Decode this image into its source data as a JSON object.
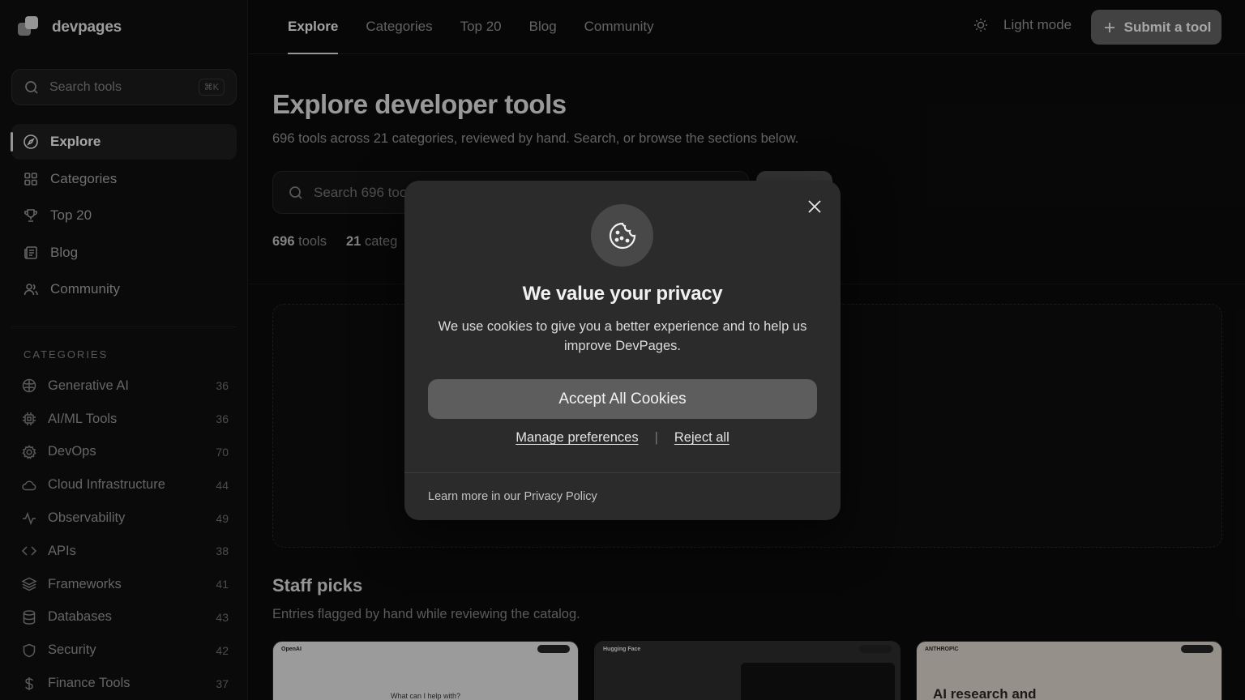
{
  "brand": {
    "name": "devpages"
  },
  "sidebar": {
    "search_placeholder": "Search tools",
    "search_shortcut": "⌘K",
    "nav": [
      {
        "label": "Explore",
        "icon": "compass-icon",
        "active": true
      },
      {
        "label": "Categories",
        "icon": "grid-icon",
        "active": false
      },
      {
        "label": "Top 20",
        "icon": "trophy-icon",
        "active": false
      },
      {
        "label": "Blog",
        "icon": "newspaper-icon",
        "active": false
      },
      {
        "label": "Community",
        "icon": "users-icon",
        "active": false
      }
    ],
    "categories_heading": "CATEGORIES",
    "categories": [
      {
        "label": "Generative AI",
        "count": "36",
        "icon": "brain-icon"
      },
      {
        "label": "AI/ML Tools",
        "count": "36",
        "icon": "cpu-icon"
      },
      {
        "label": "DevOps",
        "count": "70",
        "icon": "gear-icon"
      },
      {
        "label": "Cloud Infrastructure",
        "count": "44",
        "icon": "cloud-icon"
      },
      {
        "label": "Observability",
        "count": "49",
        "icon": "activity-icon"
      },
      {
        "label": "APIs",
        "count": "38",
        "icon": "code-icon"
      },
      {
        "label": "Frameworks",
        "count": "41",
        "icon": "layers-icon"
      },
      {
        "label": "Databases",
        "count": "43",
        "icon": "database-icon"
      },
      {
        "label": "Security",
        "count": "42",
        "icon": "shield-icon"
      },
      {
        "label": "Finance Tools",
        "count": "37",
        "icon": "dollar-icon"
      }
    ]
  },
  "topbar": {
    "tabs": [
      {
        "label": "Explore",
        "active": true
      },
      {
        "label": "Categories",
        "active": false
      },
      {
        "label": "Top 20",
        "active": false
      },
      {
        "label": "Blog",
        "active": false
      },
      {
        "label": "Community",
        "active": false
      }
    ],
    "light_mode_label": "Light mode",
    "submit_label": "Submit a tool"
  },
  "main": {
    "title": "Explore developer tools",
    "subtitle": "696 tools across 21 categories, reviewed by hand. Search, or browse the sections below.",
    "search_placeholder": "Search 696 too",
    "stats": [
      {
        "value": "696",
        "label": "tools"
      },
      {
        "value": "21",
        "label": "categ"
      }
    ],
    "staff_title": "Staff picks",
    "staff_subtitle": "Entries flagged by hand while reviewing the catalog.",
    "cards": [
      {
        "brand": "OpenAI",
        "headline": "What can I help with?"
      },
      {
        "brand": "Hugging Face",
        "headline": ""
      },
      {
        "brand": "ANTHROP\\C",
        "headline": "AI research and"
      }
    ]
  },
  "cookie_modal": {
    "title": "We value your privacy",
    "body": "We use cookies to give you a better experience and to help us improve DevPages.",
    "accept_label": "Accept All Cookies",
    "manage_label": "Manage preferences",
    "separator": "|",
    "reject_label": "Reject all",
    "footer": "Learn more in our Privacy Policy"
  },
  "colors": {
    "background": "#0b0b0b",
    "modal_bg": "#2b2b2b",
    "accept_button": "#5d5d5d",
    "submit_button": "#5c5c5c"
  }
}
